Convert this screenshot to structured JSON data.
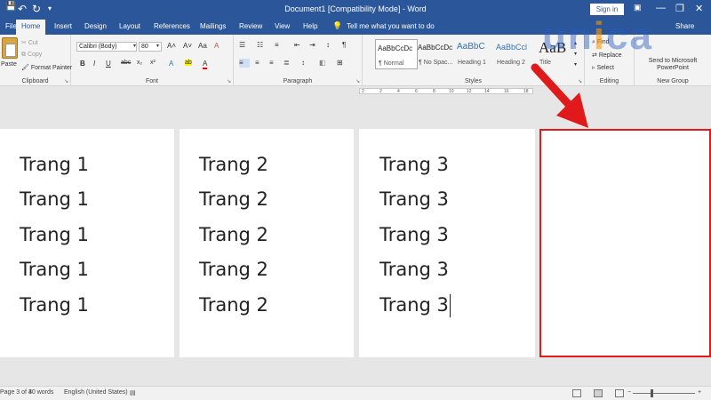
{
  "titlebar": {
    "title": "Document1 [Compatibility Mode] - Word",
    "signin": "Sign in",
    "save_icon": "save-icon",
    "undo_glyph": "↶",
    "redo_glyph": "↻",
    "minimize_glyph": "—",
    "restore_glyph": "❐",
    "close_glyph": "✕"
  },
  "tabs": [
    "File",
    "Home",
    "Insert",
    "Design",
    "Layout",
    "References",
    "Mailings",
    "Review",
    "View",
    "Help"
  ],
  "tellme": "Tell me what you want to do",
  "share": "Share",
  "clipboard": {
    "paste": "Paste",
    "cut": "Cut",
    "copy": "Copy",
    "format_painter": "Format Painter",
    "label": "Clipboard"
  },
  "font": {
    "family": "Calibri (Body)",
    "size": "80",
    "label": "Font",
    "bold": "B",
    "italic": "I",
    "underline": "U",
    "strike": "abc",
    "sub": "x₂",
    "sup": "x²",
    "grow": "A˄",
    "shrink": "A˅",
    "case": "Aa",
    "clear": "A",
    "effects": "A",
    "highlight": "ab",
    "color": "A"
  },
  "paragraph": {
    "label": "Paragraph",
    "bullets": "☰",
    "numbering": "☷",
    "multilevel": "≡",
    "decrease": "⇤",
    "increase": "⇥",
    "sort": "↕",
    "show": "¶"
  },
  "styles": {
    "label": "Styles",
    "items": [
      {
        "sample": "AaBbCcDc",
        "name": "¶ Normal"
      },
      {
        "sample": "AaBbCcDc",
        "name": "¶ No Spac..."
      },
      {
        "sample": "AaBbC",
        "name": "Heading 1"
      },
      {
        "sample": "AaBbCcl",
        "name": "Heading 2"
      },
      {
        "sample": "AaB",
        "name": "Title"
      }
    ]
  },
  "editing": {
    "label": "Editing",
    "find": "Find",
    "replace": "Replace",
    "select": "Select"
  },
  "newgroup": {
    "label": "New Group",
    "send": "Send to Microsoft PowerPoint"
  },
  "ruler": [
    "2",
    "2",
    "4",
    "6",
    "8",
    "10",
    "12",
    "14",
    "16",
    "18"
  ],
  "pages": [
    {
      "lines": [
        "Trang 1",
        "Trang 1",
        "Trang 1",
        "Trang 1",
        "Trang 1"
      ]
    },
    {
      "lines": [
        "Trang 2",
        "Trang 2",
        "Trang 2",
        "Trang 2",
        "Trang 2"
      ]
    },
    {
      "lines": [
        "Trang 3",
        "Trang 3",
        "Trang 3",
        "Trang 3",
        "Trang 3"
      ]
    }
  ],
  "status": {
    "page": "3 of 4",
    "words": "30 words",
    "language": "English (United States)"
  },
  "watermark": {
    "text": "unica"
  },
  "colors": {
    "accent": "#2b579a",
    "highlight_border": "#e0191b"
  }
}
